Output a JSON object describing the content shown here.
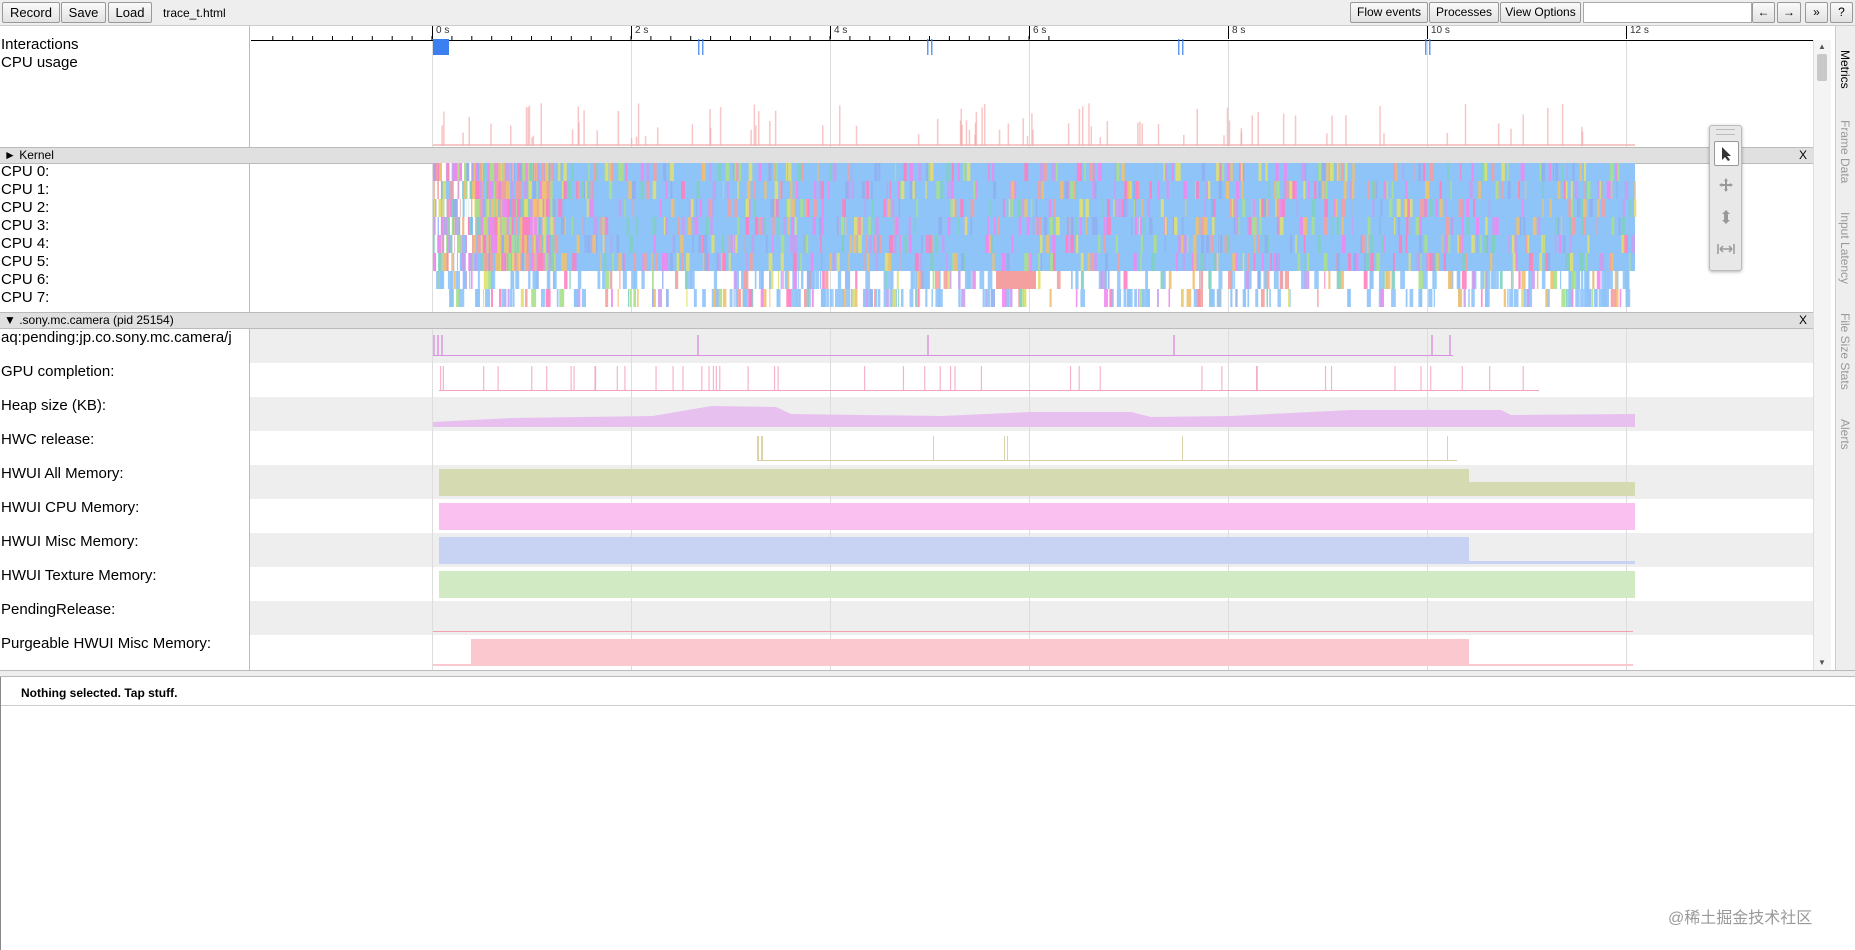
{
  "toolbar": {
    "record": "Record",
    "save": "Save",
    "load": "Load",
    "filename": "trace_t.html",
    "flow_events": "Flow events",
    "processes": "Processes",
    "view_options": "View Options",
    "search_value": "",
    "prev": "←",
    "next": "→",
    "expand": "»",
    "help": "?"
  },
  "ruler": {
    "ticks": [
      "0 s",
      "2 s",
      "4 s",
      "6 s",
      "8 s",
      "10 s",
      "12 s"
    ]
  },
  "tracks": {
    "interactions": "Interactions",
    "cpu_usage": "CPU usage",
    "kernel_group": "► Kernel",
    "cpus": [
      "CPU 0:",
      "CPU 1:",
      "CPU 2:",
      "CPU 3:",
      "CPU 4:",
      "CPU 5:",
      "CPU 6:",
      "CPU 7:"
    ],
    "process_group": "▼ .sony.mc.camera (pid 25154)",
    "counters": [
      "aq:pending:jp.co.sony.mc.camera/j",
      "GPU completion:",
      "Heap size (KB):",
      "HWC release:",
      "HWUI All Memory:",
      "HWUI CPU Memory:",
      "HWUI Misc Memory:",
      "HWUI Texture Memory:",
      "PendingRelease:",
      "Purgeable HWUI Misc Memory:"
    ],
    "close": "X",
    "colors": {
      "cpu_main": "#8fc4f8",
      "heap": "#e8c0f0",
      "hwui_all": "#d6dab0",
      "hwui_cpu": "#f9c0f0",
      "hwui_misc": "#c8d2f2",
      "hwui_texture": "#d2eac4",
      "purgeable": "#fcc8d0",
      "interactions": "#3b7ff0"
    }
  },
  "side_tabs": [
    "Metrics",
    "Frame Data",
    "Input Latency",
    "File Size Stats",
    "Alerts"
  ],
  "analysis": {
    "message": "Nothing selected. Tap stuff."
  },
  "watermark": "@稀土掘金技术社区"
}
